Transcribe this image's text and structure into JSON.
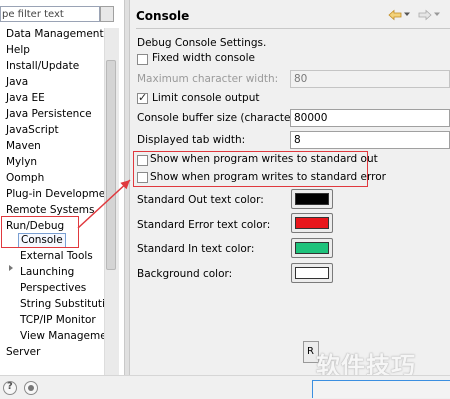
{
  "filter": {
    "placeholder": "type filter text",
    "value": "pe filter text"
  },
  "tree": {
    "items": [
      {
        "label": "Data Management"
      },
      {
        "label": "Help"
      },
      {
        "label": "Install/Update"
      },
      {
        "label": "Java"
      },
      {
        "label": "Java EE"
      },
      {
        "label": "Java Persistence"
      },
      {
        "label": "JavaScript"
      },
      {
        "label": "Maven"
      },
      {
        "label": "Mylyn"
      },
      {
        "label": "Oomph"
      },
      {
        "label": "Plug-in Development"
      },
      {
        "label": "Remote Systems"
      },
      {
        "label": "Run/Debug"
      },
      {
        "label": "Console"
      },
      {
        "label": "External Tools"
      },
      {
        "label": "Launching"
      },
      {
        "label": "Perspectives"
      },
      {
        "label": "String Substitution"
      },
      {
        "label": "TCP/IP Monitor"
      },
      {
        "label": "View Management"
      },
      {
        "label": "Server"
      }
    ],
    "selected": "Console"
  },
  "page": {
    "title": "Console",
    "description": "Debug Console Settings.",
    "fixed_width": {
      "label": "Fixed width console",
      "checked": false
    },
    "max_char_width": {
      "label": "Maximum character width:",
      "value": "80",
      "enabled": false
    },
    "limit_output": {
      "label": "Limit console output",
      "checked": true
    },
    "buffer_size": {
      "label": "Console buffer size (characters):",
      "value": "80000"
    },
    "tab_width": {
      "label": "Displayed tab width:",
      "value": "8"
    },
    "show_stdout": {
      "label": "Show when program writes to standard out",
      "checked": false
    },
    "show_stderr": {
      "label": "Show when program writes to standard error",
      "checked": false
    },
    "colors": [
      {
        "label": "Standard Out text color:",
        "color": "#000000"
      },
      {
        "label": "Standard Error text color:",
        "color": "#e8161b"
      },
      {
        "label": "Standard In text color:",
        "color": "#1ec27b"
      },
      {
        "label": "Background color:",
        "color": "#ffffff"
      }
    ],
    "restore_button_label": "R"
  },
  "watermark": "软件技巧",
  "icons": {
    "back": "arrow-left-icon",
    "forward": "arrow-right-icon",
    "help": "help-icon",
    "record": "record-icon"
  },
  "accent_colors": {
    "annotation": "#e0393e",
    "selection": "#7a9fd2",
    "nav_arrow": "#d9a441"
  }
}
